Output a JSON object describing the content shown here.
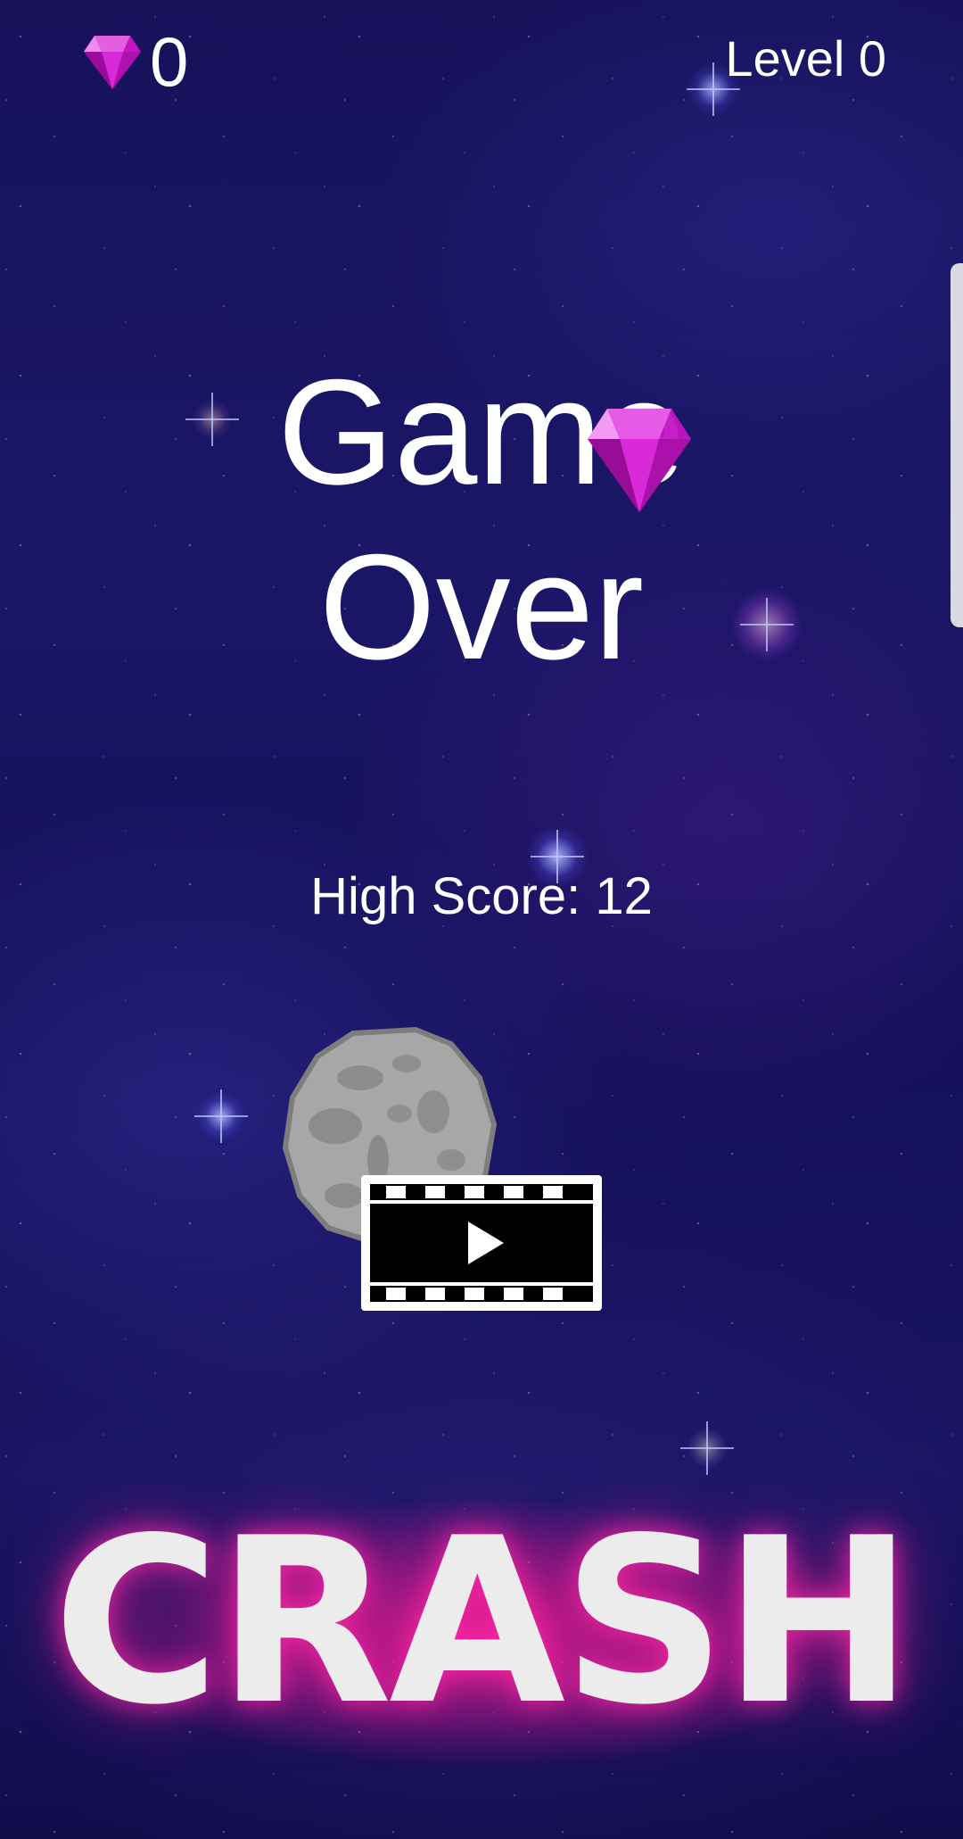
{
  "hud": {
    "gem_count": "0",
    "level_label": "Level 0"
  },
  "game_over": {
    "line1": "Game",
    "line2": "Over",
    "high_score": "High Score: 12"
  },
  "watch_video": {
    "icon": "video-play-icon"
  },
  "brand": {
    "logo_text": "CRASH"
  },
  "colors": {
    "background": "#1b1667",
    "gem": "#d11ad1",
    "crash_glow": "#ff1e96",
    "text": "#ffffff"
  }
}
